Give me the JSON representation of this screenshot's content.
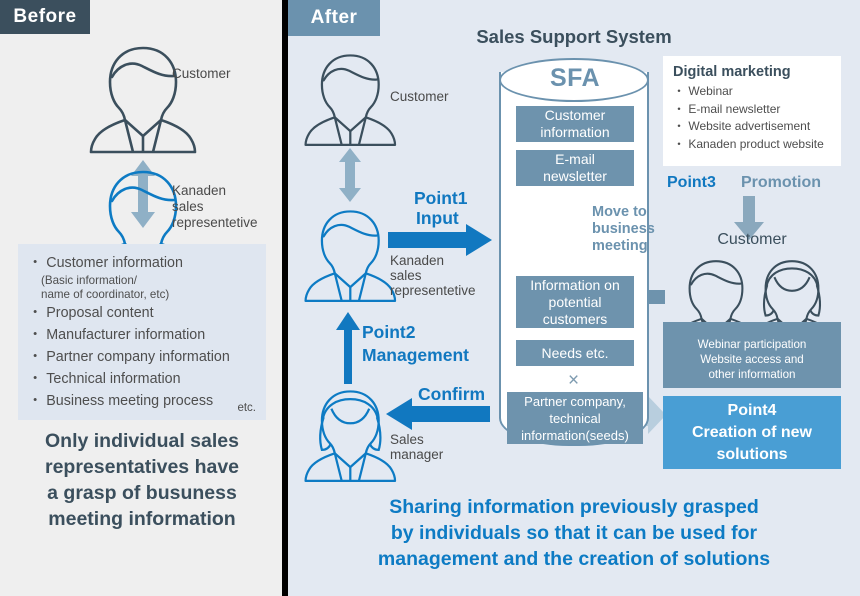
{
  "tabs": {
    "before": "Before",
    "after": "After"
  },
  "colors": {
    "before_tab": "#3b4f5d",
    "after_tab": "#6b92ae",
    "left_panel_bg": "#efefef",
    "right_panel_bg": "#e3e9f2",
    "box_fill": "#6e93ad",
    "accent_blue": "#1178c0",
    "point4_fill": "#499ed4",
    "arrow_gray": "#8aa8bd",
    "person_dark": "#3b4f5d",
    "person_blue": "#0d7bc4"
  },
  "left": {
    "customer_label": "Customer",
    "sales_rep_label": "Kanaden\nsales\nrepresentetive",
    "sales_rep_line1": "Kanaden",
    "sales_rep_line2": "sales",
    "sales_rep_line3": "representetive",
    "list_items": [
      "・ Customer information",
      "・ Proposal content",
      "・ Manufacturer information",
      "・ Partner company information",
      "・ Technical information",
      "・ Business meeting process"
    ],
    "customer_sub_line1": "(Basic information/",
    "customer_sub_line2": "name of coordinator, etc)",
    "etc": "etc.",
    "caption_line1": "Only individual sales",
    "caption_line2": "representatives have",
    "caption_line3": "a grasp of busuness",
    "caption_line4": "meeting information"
  },
  "right": {
    "system_title": "Sales Support System",
    "customer_label": "Customer",
    "sales_rep_line1": "Kanaden",
    "sales_rep_line2": "sales",
    "sales_rep_line3": "representetive",
    "sales_manager_line1": "Sales",
    "sales_manager_line2": "manager",
    "point1_label": "Point1",
    "point1_action": "Input",
    "point2_label": "Point2",
    "point2_action": "Management",
    "confirm_label": "Confirm",
    "point3_label": "Point3",
    "promotion_label": "Promotion",
    "move_line1": "Move to",
    "move_line2": "business",
    "move_line3": "meeting",
    "x_mark": "×",
    "sfa": {
      "title": "SFA",
      "boxes": [
        {
          "line1": "Customer",
          "line2": "information"
        },
        {
          "line1": "E-mail",
          "line2": "newsletter"
        },
        {
          "line1": "Information on",
          "line2": "potential",
          "line3": "customers"
        },
        {
          "line1": "Needs etc."
        },
        {
          "line1": "Partner company,",
          "line2": "technical",
          "line3": "information(seeds)"
        }
      ]
    },
    "digital_marketing": {
      "title": "Digital marketing",
      "items": [
        "・ Webinar",
        "・ E-mail newsletter",
        "・ Website advertisement",
        "・ Kanaden product website"
      ]
    },
    "customer2_label": "Customer",
    "webinar_box": {
      "line1": "Webinar participation",
      "line2": "Website access and",
      "line3": "other information"
    },
    "point4_box": {
      "line1": "Point4",
      "line2": "Creation of new",
      "line3": "solutions"
    },
    "caption_line1": "Sharing information previously grasped",
    "caption_line2": "by individuals so that it can be used for",
    "caption_line3": "management and the creation of solutions"
  }
}
